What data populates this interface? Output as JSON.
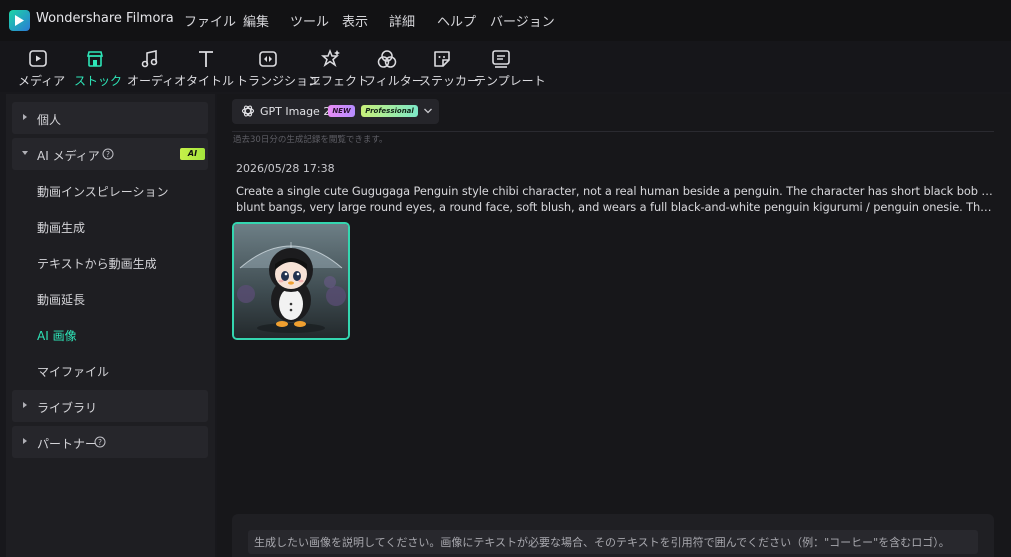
{
  "app": {
    "title": "Wondershare Filmora"
  },
  "menu": [
    "ファイル",
    "編集",
    "ツール",
    "表示",
    "詳細",
    "ヘルプ",
    "バージョン"
  ],
  "toolbar": [
    {
      "label": "メディア",
      "icon": "media-icon"
    },
    {
      "label": "ストック",
      "icon": "stock-icon",
      "active": true
    },
    {
      "label": "オーディオ",
      "icon": "audio-icon"
    },
    {
      "label": "タイトル",
      "icon": "title-icon"
    },
    {
      "label": "トランジション",
      "icon": "transition-icon"
    },
    {
      "label": "エフェクト",
      "icon": "effect-icon"
    },
    {
      "label": "フィルター",
      "icon": "filter-icon"
    },
    {
      "label": "ステッカー",
      "icon": "sticker-icon"
    },
    {
      "label": "テンプレート",
      "icon": "template-icon"
    }
  ],
  "sidebar": {
    "personal": "個人",
    "ai_media": "AI メディア",
    "ai_badge": "AI",
    "items": [
      "動画インスピレーション",
      "動画生成",
      "テキストから動画生成",
      "動画延長",
      "AI 画像",
      "マイファイル"
    ],
    "active_item": "AI 画像",
    "library": "ライブラリ",
    "partner": "パートナー"
  },
  "main": {
    "model": {
      "name": "GPT Image 2",
      "badge_new": "NEW",
      "badge_pro": "Professional"
    },
    "history_note": "過去30日分の生成記録を閲覧できます。",
    "entry": {
      "timestamp": "2026/05/28 17:38",
      "prompt_line1": "Create a single cute Gugugaga Penguin style chibi character, not a real human beside a penguin. The character has short black bob hair with",
      "prompt_line2": "blunt bangs, very large round eyes, a round face, soft blush, and wears a full black-and-white penguin kigurumi / penguin onesie. The hood h..."
    },
    "input": {
      "placeholder": "生成したい画像を説明してください。画像にテキストが必要な場合、そのテキストを引用符で囲んでください（例：\"コーヒー\"を含むロゴ）。"
    }
  },
  "colors": {
    "accent": "#2ee5b8",
    "background": "#18181c"
  }
}
